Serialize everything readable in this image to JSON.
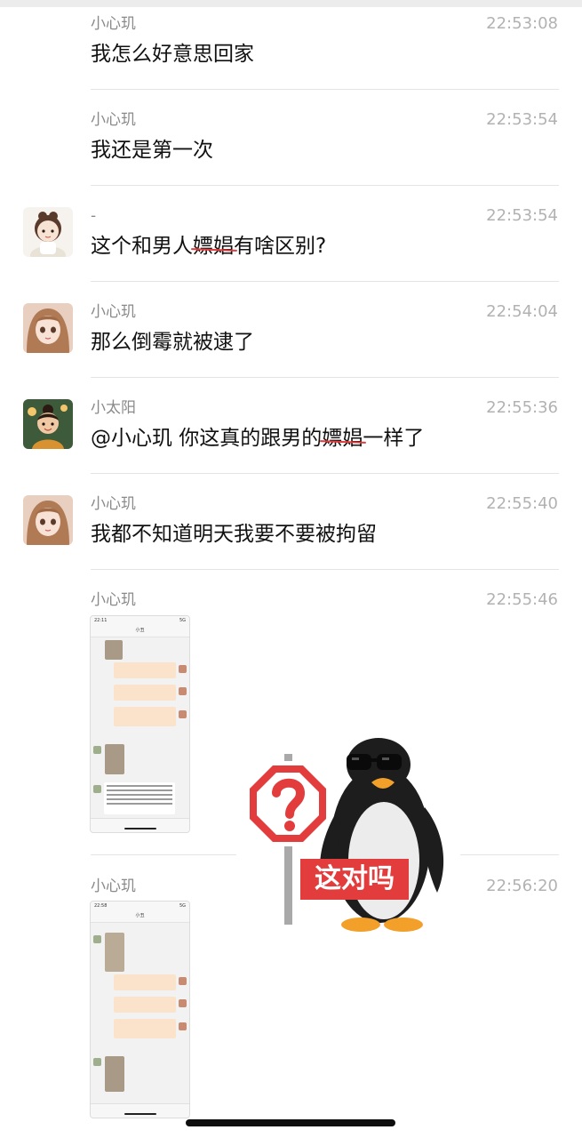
{
  "messages": [
    {
      "sender": "小心玑",
      "time": "22:53:08",
      "text": "我怎么好意思回家",
      "avatar": "none"
    },
    {
      "sender": "小心玑",
      "time": "22:53:54",
      "text": "我还是第一次",
      "avatar": "none"
    },
    {
      "sender": "-",
      "time": "22:53:54",
      "text_parts": [
        "这个和男人",
        "嫖娼",
        "有啥区别?"
      ],
      "avatar": "chibi-girl-avatar"
    },
    {
      "sender": "小心玑",
      "time": "22:54:04",
      "text": "那么倒霉就被逮了",
      "avatar": "anime-girl-avatar"
    },
    {
      "sender": "小太阳",
      "time": "22:55:36",
      "text_parts": [
        "@小心玑 你这真的跟男的",
        "嫖娼",
        "一样了"
      ],
      "avatar": "cartoon-child-avatar"
    },
    {
      "sender": "小心玑",
      "time": "22:55:40",
      "text": "我都不知道明天我要不要被拘留",
      "avatar": "anime-girl-avatar"
    },
    {
      "sender": "小心玑",
      "time": "22:55:46",
      "attachment": "chat-screenshot-image",
      "screenshot": {
        "status_time": "22:11",
        "status_right": "5G",
        "nav_title": "小丑"
      }
    },
    {
      "sender": "小心玑",
      "time": "22:56:20",
      "attachment": "chat-screenshot-image",
      "screenshot": {
        "status_time": "22:58",
        "status_right": "5G",
        "nav_title": "小丑"
      }
    }
  ],
  "sticker": {
    "sign_label": "这对吗",
    "icon": "penguin-question-stop-sign"
  },
  "colors": {
    "strike": "#e23c3c",
    "sign_red": "#e23c3c",
    "time_gray": "#b2b2b2"
  }
}
